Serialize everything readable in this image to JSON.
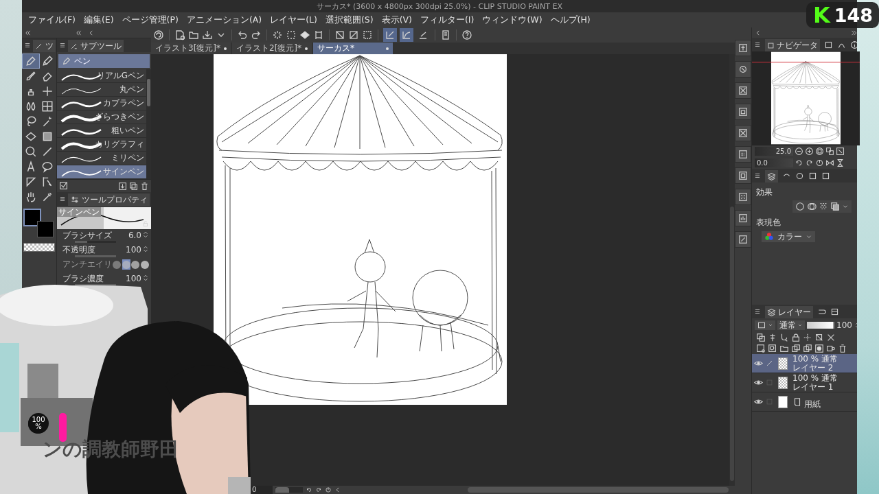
{
  "window": {
    "title": "サーカス* (3600 x 4800px 300dpi 25.0%) - CLIP STUDIO PAINT EX"
  },
  "menu": [
    "ファイル(F)",
    "編集(E)",
    "ページ管理(P)",
    "アニメーション(A)",
    "レイヤー(L)",
    "選択範囲(S)",
    "表示(V)",
    "フィルター(I)",
    "ウィンドウ(W)",
    "ヘルプ(H)"
  ],
  "snap_toggles": [
    {
      "on": true
    },
    {
      "on": true
    },
    {
      "on": false
    }
  ],
  "doc_tabs": [
    {
      "label": "イラスト3[復元]*",
      "selected": false
    },
    {
      "label": "イラスト2[復元]*",
      "selected": false
    },
    {
      "label": "サーカス*",
      "selected": true
    }
  ],
  "tool_panel": {
    "tab": "ツ",
    "tools": [
      {
        "selected": true
      },
      {
        "selected": false
      },
      {
        "selected": false
      },
      {
        "selected": false
      },
      {
        "selected": false
      },
      {
        "selected": false
      },
      {
        "selected": false
      },
      {
        "selected": false
      },
      {
        "selected": false
      },
      {
        "selected": false
      },
      {
        "selected": false
      },
      {
        "selected": false
      },
      {
        "selected": false
      },
      {
        "selected": false
      },
      {
        "selected": false
      },
      {
        "selected": false
      },
      {
        "selected": false
      },
      {
        "selected": false
      },
      {
        "selected": false
      },
      {
        "selected": false
      }
    ]
  },
  "subtool_panel": {
    "tab": "サブツール",
    "group": "ペン",
    "brushes": [
      {
        "label": "リアルGペン",
        "selected": false
      },
      {
        "label": "丸ペン",
        "selected": false
      },
      {
        "label": "カブラペン",
        "selected": false
      },
      {
        "label": "ざらつきペン",
        "selected": false
      },
      {
        "label": "粗いペン",
        "selected": false
      },
      {
        "label": "カリグラフィ",
        "selected": false
      },
      {
        "label": "ミリペン",
        "selected": false
      },
      {
        "label": "サインペン",
        "selected": true
      }
    ]
  },
  "tool_property": {
    "tab": "ツールプロパティ",
    "preview_label": "サインペン",
    "rows": [
      {
        "kind": "slider",
        "label": "ブラシサイズ",
        "value": "6.0",
        "level": 0.3
      },
      {
        "kind": "slider",
        "label": "不透明度",
        "value": "100",
        "level": 1
      },
      {
        "kind": "choice",
        "label": "アンチエイリ",
        "options": [
          {
            "selected": false
          },
          {
            "selected": true
          },
          {
            "selected": false
          },
          {
            "selected": false
          }
        ]
      },
      {
        "kind": "slider",
        "label": "ブラシ濃度",
        "value": "100",
        "level": 1
      }
    ]
  },
  "navigator": {
    "tab": "ナビゲータ",
    "zoom": "25.0",
    "rotation": "0.0"
  },
  "layer_property": {
    "effect_label": "効果",
    "color_label": "表現色",
    "color_mode": "カラー"
  },
  "layers_panel": {
    "tab": "レイヤー",
    "blend_mode": "通常",
    "opacity": "100",
    "level": 1,
    "layers": [
      {
        "kind": "raster",
        "mode": "100 % 通常",
        "name": "レイヤー 2",
        "selected": true,
        "visible": true,
        "editing": true
      },
      {
        "kind": "raster",
        "mode": "100 % 通常",
        "name": "レイヤー 1",
        "selected": false,
        "visible": true,
        "editing": false
      },
      {
        "kind": "paper",
        "name": "用紙",
        "selected": false,
        "visible": true,
        "editing": false
      }
    ]
  },
  "status_bar": {
    "angle": "0",
    "angle_slider": {
      "level": 0.5
    }
  },
  "overlay": {
    "logo": "K",
    "viewer_count": "148",
    "caption": "ンの調教師野田",
    "meter": "100 %"
  }
}
